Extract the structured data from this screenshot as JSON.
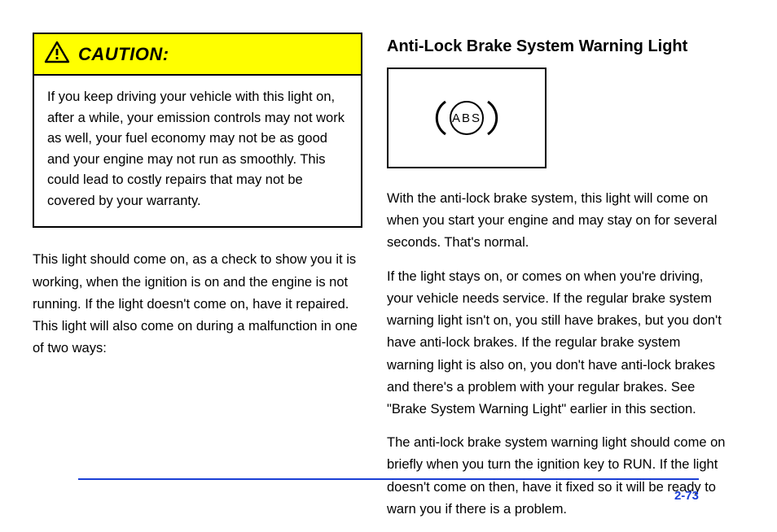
{
  "caution": {
    "title": "CAUTION:",
    "body": "If you keep driving your vehicle with this light on, after a while, your emission controls may not work as well, your fuel economy may not be as good and your engine may not run as smoothly. This could lead to costly repairs that may not be covered by your warranty."
  },
  "after_caution": "This light should come on, as a check to show you it is working, when the ignition is on and the engine is not running. If the light doesn't come on, have it repaired. This light will also come on during a malfunction in one of two ways:",
  "right": {
    "heading": "Anti-Lock Brake System Warning Light",
    "p1": "With the anti-lock brake system, this light will come on when you start your engine and may stay on for several seconds. That's normal.",
    "p2": "If the light stays on, or comes on when you're driving, your vehicle needs service. If the regular brake system warning light isn't on, you still have brakes, but you don't have anti-lock brakes. If the regular brake system warning light is also on, you don't have anti-lock brakes and there's a problem with your regular brakes. See \"Brake System Warning Light\" earlier in this section.",
    "p3": "The anti-lock brake system warning light should come on briefly when you turn the ignition key to RUN. If the light doesn't come on then, have it fixed so it will be ready to warn you if there is a problem."
  },
  "abs_label": "ABS",
  "page_number": "2-73"
}
